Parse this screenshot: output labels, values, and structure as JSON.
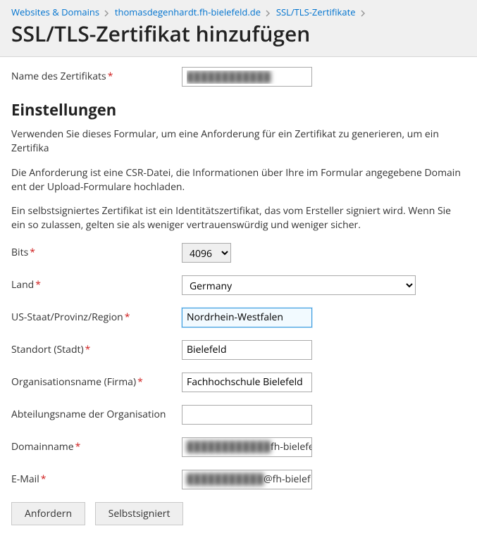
{
  "breadcrumb": {
    "items": [
      {
        "label": "Websites & Domains"
      },
      {
        "label": "thomasdegenhardt.fh-bielefeld.de"
      },
      {
        "label": "SSL/TLS-Zertifikate"
      }
    ]
  },
  "page_title": "SSL/TLS-Zertifikat hinzufügen",
  "cert_name": {
    "label": "Name des Zertifikats",
    "value": "████████████"
  },
  "settings_heading": "Einstellungen",
  "help": {
    "p1": "Verwenden Sie dieses Formular, um eine Anforderung für ein Zertifikat zu generieren, um ein Zertifika",
    "p2": "Die Anforderung ist eine CSR-Datei, die Informationen über Ihre im Formular angegebene Domain ent der Upload-Formulare hochladen.",
    "p3": "Ein selbstsigniertes Zertifikat ist ein Identitätszertifikat, das vom Ersteller signiert wird. Wenn Sie ein so zulassen, gelten sie als weniger vertrauenswürdig und weniger sicher."
  },
  "fields": {
    "bits": {
      "label": "Bits",
      "value": "4096"
    },
    "country": {
      "label": "Land",
      "value": "Germany"
    },
    "state": {
      "label": "US-Staat/Provinz/Region",
      "value": "Nordrhein-Westfalen"
    },
    "city": {
      "label": "Standort (Stadt)",
      "value": "Bielefeld"
    },
    "org": {
      "label": "Organisationsname (Firma)",
      "value": "Fachhochschule Bielefeld"
    },
    "orgunit": {
      "label": "Abteilungsname der Organisation",
      "value": ""
    },
    "domain": {
      "label": "Domainname",
      "prefix_masked": "████████████",
      "suffix": "fh-bielefel"
    },
    "email": {
      "label": "E-Mail",
      "prefix_masked": "███████████",
      "suffix": "@fh-bielef"
    }
  },
  "buttons": {
    "request": "Anfordern",
    "selfsigned": "Selbstsigniert"
  }
}
